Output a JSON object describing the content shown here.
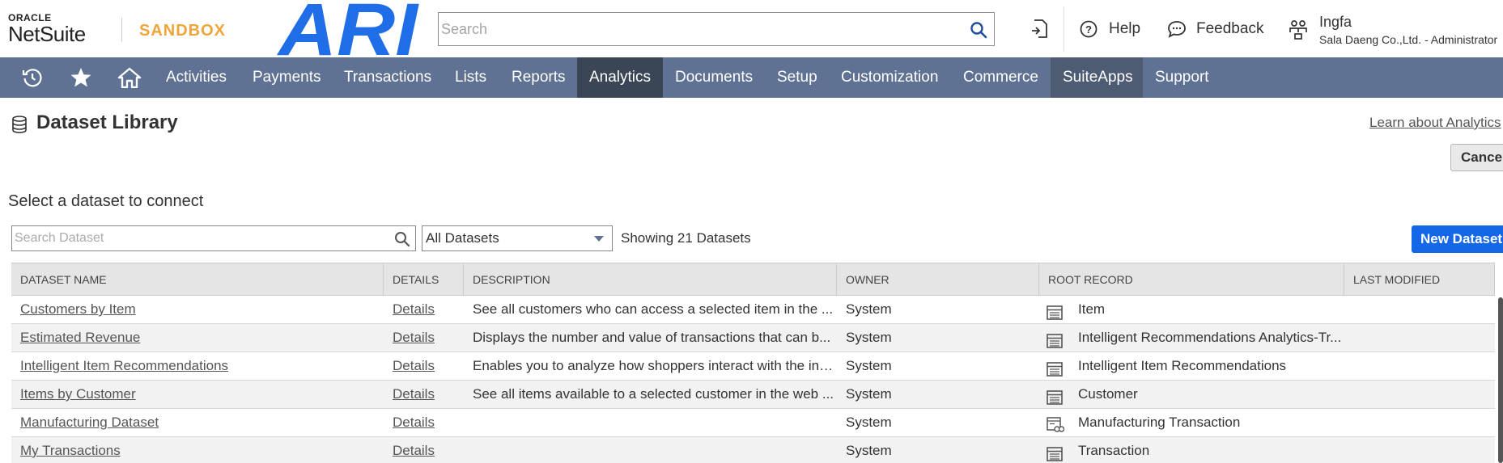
{
  "header": {
    "oracle_label": "ORACLE",
    "netsuite_label": "NetSuite",
    "sandbox_label": "SANDBOX",
    "company_logo_text": "ARI",
    "search_placeholder": "Search",
    "help_label": "Help",
    "feedback_label": "Feedback",
    "user_name": "Ingfa",
    "user_role": "Sala Daeng Co.,Ltd. - Administrator",
    "brand_color": "#f0a53a",
    "logo_color": "#1f6ee8"
  },
  "nav": {
    "icons": [
      "recent-icon",
      "star-icon",
      "home-icon"
    ],
    "items": [
      "Activities",
      "Payments",
      "Transactions",
      "Lists",
      "Reports",
      "Analytics",
      "Documents",
      "Setup",
      "Customization",
      "Commerce",
      "SuiteApps",
      "Support"
    ],
    "active": "Analytics",
    "bar_color": "#5f7293"
  },
  "page": {
    "title": "Dataset Library",
    "learn_link": "Learn about Analytics",
    "cancel_label": "Cancel",
    "section_title": "Select a dataset to connect",
    "search_placeholder": "Search Dataset",
    "filter_value": "All Datasets",
    "showing_text": "Showing 21 Datasets",
    "new_dataset_label": "New Dataset",
    "accent_color": "#1467e6"
  },
  "table": {
    "headers": [
      "DATASET NAME",
      "DETAILS",
      "DESCRIPTION",
      "OWNER",
      "ROOT RECORD",
      "LAST MODIFIED"
    ],
    "rows": [
      {
        "name": "Customers by Item",
        "details": "Details",
        "description": "See all customers who can access a selected item in the ...",
        "owner": "System",
        "root_record": "Item",
        "root_icon": "record-list-icon",
        "last_modified": ""
      },
      {
        "name": "Estimated Revenue",
        "details": "Details",
        "description": "Displays the number and value of transactions that can b...",
        "owner": "System",
        "root_record": "Intelligent Recommendations Analytics-Tr...",
        "root_icon": "record-list-icon",
        "last_modified": ""
      },
      {
        "name": "Intelligent Item Recommendations",
        "details": "Details",
        "description": "Enables you to analyze how shoppers interact with the int...",
        "owner": "System",
        "root_record": "Intelligent Item Recommendations",
        "root_icon": "record-list-icon",
        "last_modified": ""
      },
      {
        "name": "Items by Customer",
        "details": "Details",
        "description": "See all items available to a selected customer in the web ...",
        "owner": "System",
        "root_record": "Customer",
        "root_icon": "record-list-icon",
        "last_modified": ""
      },
      {
        "name": "Manufacturing Dataset",
        "details": "Details",
        "description": "",
        "owner": "System",
        "root_record": "Manufacturing Transaction",
        "root_icon": "record-custom-icon",
        "last_modified": ""
      },
      {
        "name": "My Transactions",
        "details": "Details",
        "description": "",
        "owner": "System",
        "root_record": "Transaction",
        "root_icon": "record-list-icon",
        "last_modified": ""
      }
    ]
  }
}
